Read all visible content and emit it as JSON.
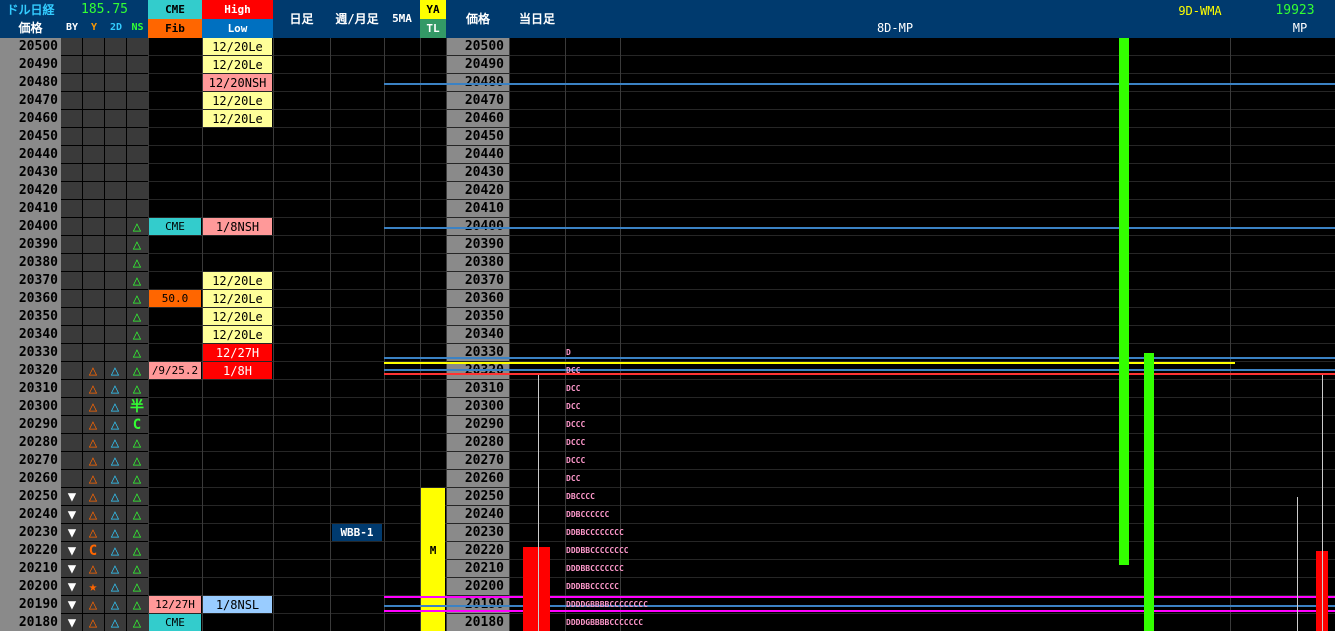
{
  "header": {
    "title": "ドル日経",
    "rate": "185.75",
    "price_label": "価格",
    "cols": {
      "by": "BY",
      "y": "Y",
      "d2": "2D",
      "ns": "NS"
    },
    "cme": "CME",
    "fib": "Fib",
    "high": "High",
    "low": "Low",
    "daily": "日足",
    "weekly_monthly": "週/月足",
    "ma5": "5MA",
    "ya": "YA",
    "tl": "TL",
    "price_label2": "価格",
    "today": "当日足",
    "mp8d": "8D-MP",
    "wma9d": "9D-WMA",
    "mp_value": "19923",
    "mp": "MP"
  },
  "colors": {
    "header_bg": "#003a6e",
    "price_bg": "#8a8a8a",
    "cme_cyan": "#33cccc",
    "high_red": "#ff0000",
    "low_blue": "#0070c0",
    "label_yellow": "#ffff99",
    "label_pink": "#ff9999",
    "fib_orange": "#ff6600",
    "ya_yellow": "#ffff00",
    "mp_green": "#33ff00",
    "tpo_pink": "#ff99cc",
    "line_blue": "#3b82c4",
    "line_yellow": "#ffff00",
    "line_red": "#ff3333",
    "line_magenta": "#ff00ff"
  },
  "chart_data": {
    "type": "table",
    "prices": [
      20500,
      20490,
      20480,
      20470,
      20460,
      20450,
      20440,
      20430,
      20420,
      20410,
      20400,
      20390,
      20380,
      20370,
      20360,
      20350,
      20340,
      20330,
      20320,
      20310,
      20300,
      20290,
      20280,
      20270,
      20260,
      20250,
      20240,
      20230,
      20220,
      20210,
      20200,
      20190,
      20180
    ],
    "by_marks": {
      "20250": "▼",
      "20240": "▼",
      "20230": "▼",
      "20220": "▼",
      "20210": "▼",
      "20200": "▼",
      "20190": "▼",
      "20180": "▼"
    },
    "y_marks": {
      "20320": "△",
      "20310": "△",
      "20300": "△",
      "20290": "△",
      "20280": "△",
      "20270": "△",
      "20260": "△",
      "20250": "△",
      "20240": "△",
      "20230": "△",
      "20220": "C",
      "20210": "△",
      "20200": "★",
      "20190": "△",
      "20180": "△"
    },
    "d2_marks": {
      "20320": "△",
      "20310": "△",
      "20300": "△",
      "20290": "△",
      "20280": "△",
      "20270": "△",
      "20260": "△",
      "20250": "△",
      "20240": "△",
      "20230": "△",
      "20220": "△",
      "20210": "△",
      "20200": "△",
      "20190": "△",
      "20180": "△"
    },
    "ns_marks": {
      "20400": "△",
      "20390": "△",
      "20380": "△",
      "20370": "△",
      "20360": "△",
      "20350": "△",
      "20340": "△",
      "20330": "△",
      "20320": "△",
      "20310": "△",
      "20300": "半",
      "20290": "C",
      "20280": "△",
      "20270": "△",
      "20260": "△",
      "20250": "△",
      "20240": "△",
      "20230": "△",
      "20220": "△",
      "20210": "△",
      "20200": "△",
      "20190": "△",
      "20180": "△"
    },
    "cme_fib": [
      {
        "price": 20400,
        "text": "CME",
        "style": "cyan"
      },
      {
        "price": 20360,
        "text": "50.0",
        "style": "orange"
      },
      {
        "price": 20320,
        "text": "/9/25.2",
        "style": "pink"
      },
      {
        "price": 20190,
        "text": "12/27H",
        "style": "pink"
      },
      {
        "price": 20180,
        "text": "CME",
        "style": "cyan"
      }
    ],
    "high_low": [
      {
        "price": 20500,
        "text": "12/20Le",
        "style": "yellow"
      },
      {
        "price": 20490,
        "text": "12/20Le",
        "style": "yellow"
      },
      {
        "price": 20480,
        "text": "12/20NSH",
        "style": "pink"
      },
      {
        "price": 20470,
        "text": "12/20Le",
        "style": "yellow"
      },
      {
        "price": 20460,
        "text": "12/20Le",
        "style": "yellow"
      },
      {
        "price": 20400,
        "text": "1/8NSH",
        "style": "pink"
      },
      {
        "price": 20370,
        "text": "12/20Le",
        "style": "yellow"
      },
      {
        "price": 20360,
        "text": "12/20Le",
        "style": "yellow"
      },
      {
        "price": 20350,
        "text": "12/20Le",
        "style": "yellow"
      },
      {
        "price": 20340,
        "text": "12/20Le",
        "style": "yellow"
      },
      {
        "price": 20330,
        "text": "12/27H",
        "style": "red"
      },
      {
        "price": 20320,
        "text": "1/8H",
        "style": "red"
      },
      {
        "price": 20190,
        "text": "1/8NSL",
        "style": "lightblue"
      }
    ],
    "weekly_label": {
      "price": 20230,
      "text": "WBB-1"
    },
    "ya_range": {
      "from": 20180,
      "to": 20250
    },
    "ya_label": {
      "price": 20220,
      "text": "M"
    },
    "tpo_rows": [
      {
        "price": 20330,
        "text": "D"
      },
      {
        "price": 20320,
        "text": "DCC"
      },
      {
        "price": 20310,
        "text": "DCC"
      },
      {
        "price": 20300,
        "text": "DCC"
      },
      {
        "price": 20290,
        "text": "DCCC"
      },
      {
        "price": 20280,
        "text": "DCCC"
      },
      {
        "price": 20270,
        "text": "DCCC"
      },
      {
        "price": 20260,
        "text": "DCC"
      },
      {
        "price": 20250,
        "text": "DBCCCC"
      },
      {
        "price": 20240,
        "text": "DDBCCCCCC"
      },
      {
        "price": 20230,
        "text": "DDBBCCCCCCCC"
      },
      {
        "price": 20220,
        "text": "DDDBBCCCCCCCC"
      },
      {
        "price": 20210,
        "text": "DDDBBCCCCCCC"
      },
      {
        "price": 20200,
        "text": "DDDBBCCCCCC"
      },
      {
        "price": 20190,
        "text": "DDDDGBBBBCCCCCCCC"
      },
      {
        "price": 20180,
        "text": "DDDDGBBBBCCCCCCC"
      }
    ],
    "levels": [
      {
        "price": 20480,
        "color": "#3b82c4"
      },
      {
        "price": 20400,
        "color": "#3b82c4"
      },
      {
        "price": 20328,
        "color": "#3b82c4"
      },
      {
        "price": 20325,
        "color": "#ffff00"
      },
      {
        "price": 20321,
        "color": "#3b82c4"
      },
      {
        "price": 20319,
        "color": "#ff3333"
      },
      {
        "price": 20195,
        "color": "#ff00ff"
      },
      {
        "price": 20190,
        "color": "#3b82c4"
      },
      {
        "price": 20187,
        "color": "#ff00ff"
      }
    ],
    "candles": [
      {
        "kind": "red",
        "open": 20222,
        "close": 20175
      },
      {
        "kind": "red",
        "open": 20220,
        "close": 20175
      }
    ],
    "mp_bars": [
      {
        "kind": "green",
        "from": 20505,
        "to": 20212
      },
      {
        "kind": "green",
        "from": 20330,
        "to": 20170
      }
    ]
  }
}
